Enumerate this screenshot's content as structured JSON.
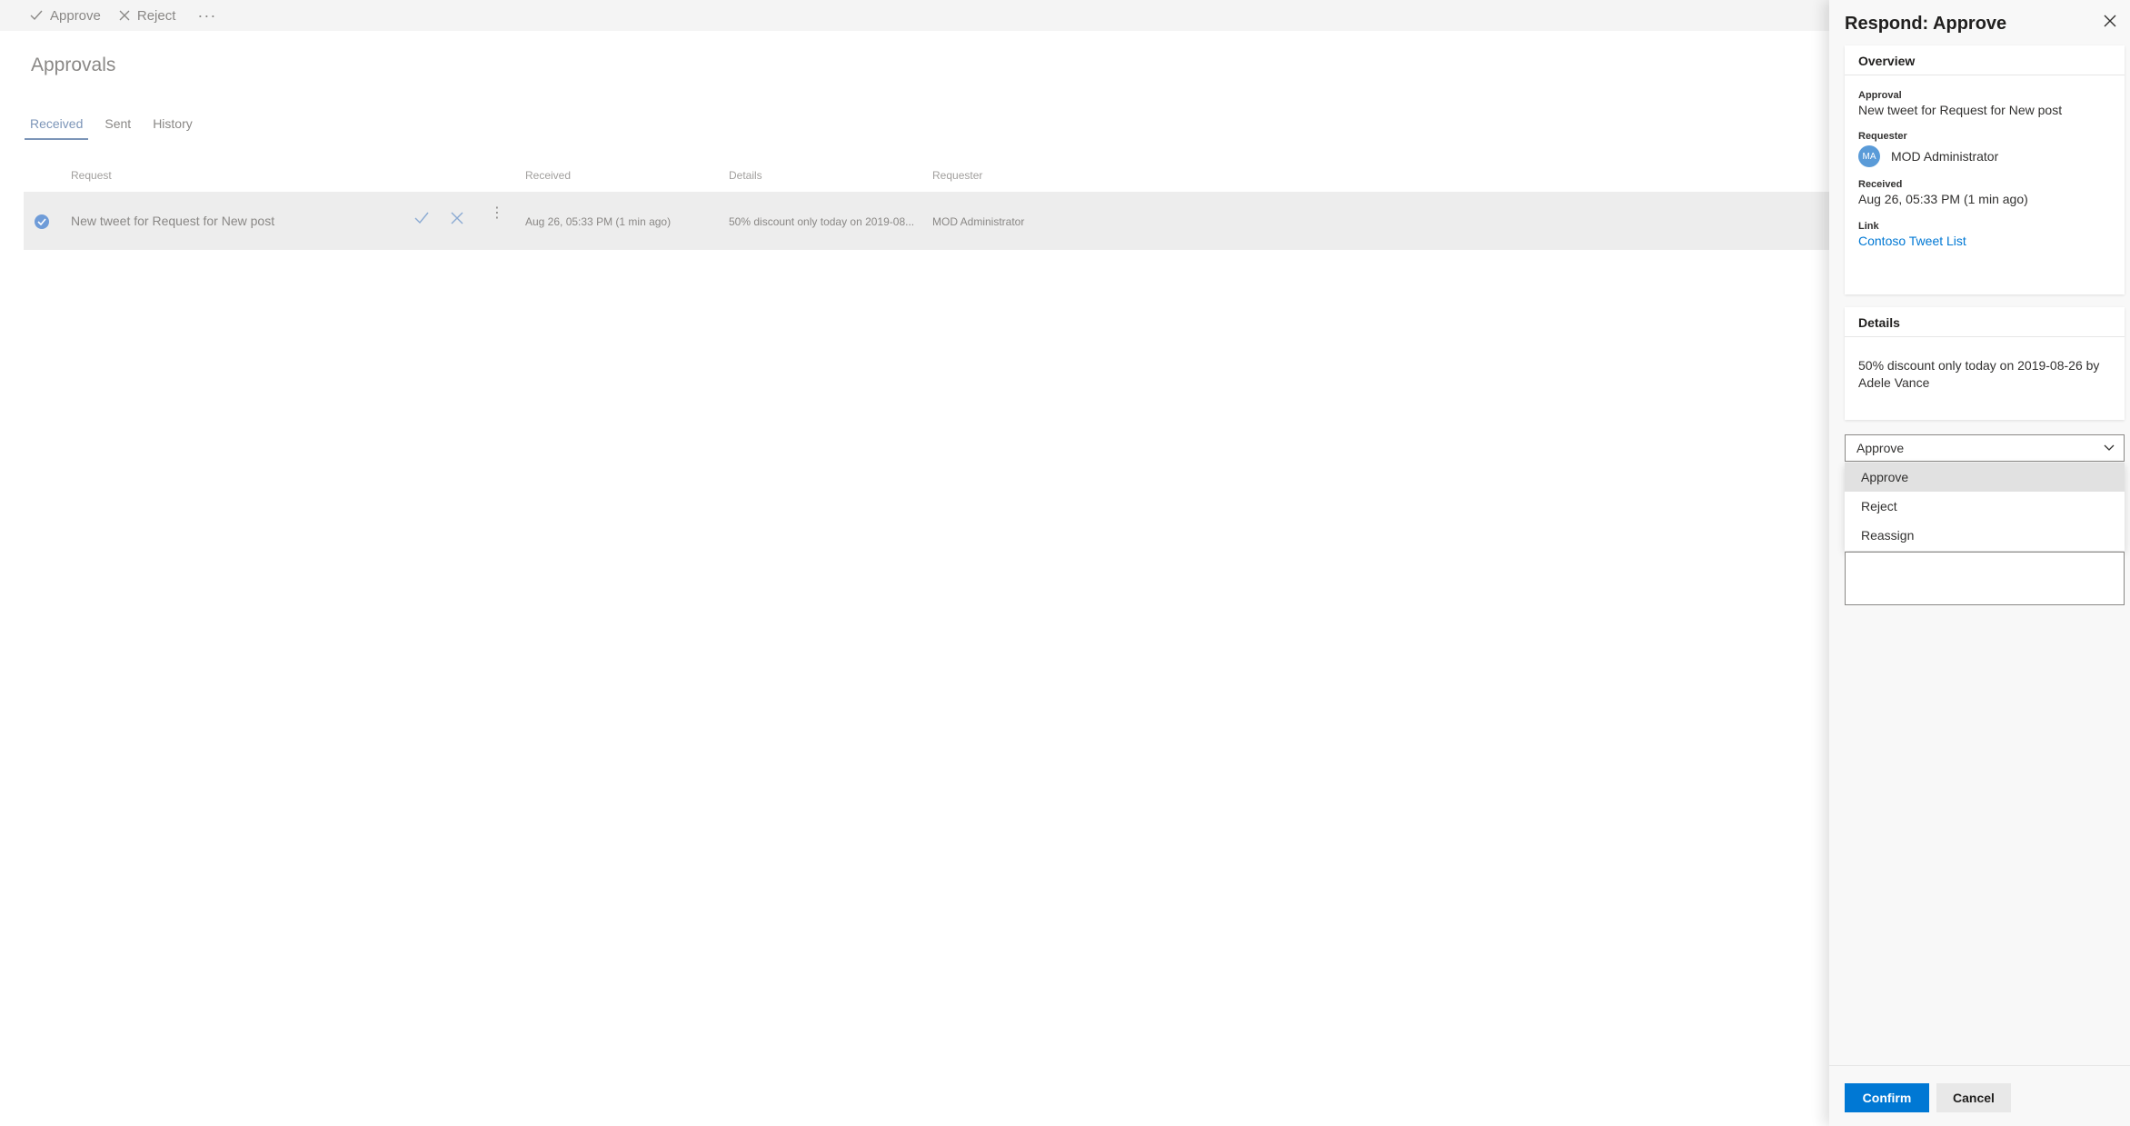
{
  "commandbar": {
    "approve_label": "Approve",
    "reject_label": "Reject",
    "more_label": "···"
  },
  "page": {
    "title": "Approvals"
  },
  "tabs": [
    {
      "label": "Received"
    },
    {
      "label": "Sent"
    },
    {
      "label": "History"
    }
  ],
  "table": {
    "headers": {
      "request": "Request",
      "received": "Received",
      "details": "Details",
      "requester": "Requester"
    },
    "rows": [
      {
        "request": "New tweet for Request for New post",
        "received": "Aug 26, 05:33 PM (1 min ago)",
        "details": "50% discount only today on 2019-08...",
        "requester": "MOD Administrator",
        "more": "⋮"
      }
    ]
  },
  "panel": {
    "title": "Respond: Approve",
    "overview": {
      "header": "Overview",
      "approval_label": "Approval",
      "approval_value": "New tweet for Request for New post",
      "requester_label": "Requester",
      "requester_initials": "MA",
      "requester_name": "MOD Administrator",
      "received_label": "Received",
      "received_value": "Aug 26, 05:33 PM (1 min ago)",
      "link_label": "Link",
      "link_value": "Contoso Tweet List"
    },
    "details": {
      "header": "Details",
      "text": "50% discount only today on 2019-08-26 by Adele Vance"
    },
    "response": {
      "selected": "Approve",
      "options": [
        "Approve",
        "Reject",
        "Reassign"
      ]
    },
    "confirm_label": "Confirm",
    "cancel_label": "Cancel"
  },
  "colors": {
    "accent": "#0078d4",
    "tab_active_dimmed": "#7c95b8",
    "avatar": "#5a9bd8"
  }
}
